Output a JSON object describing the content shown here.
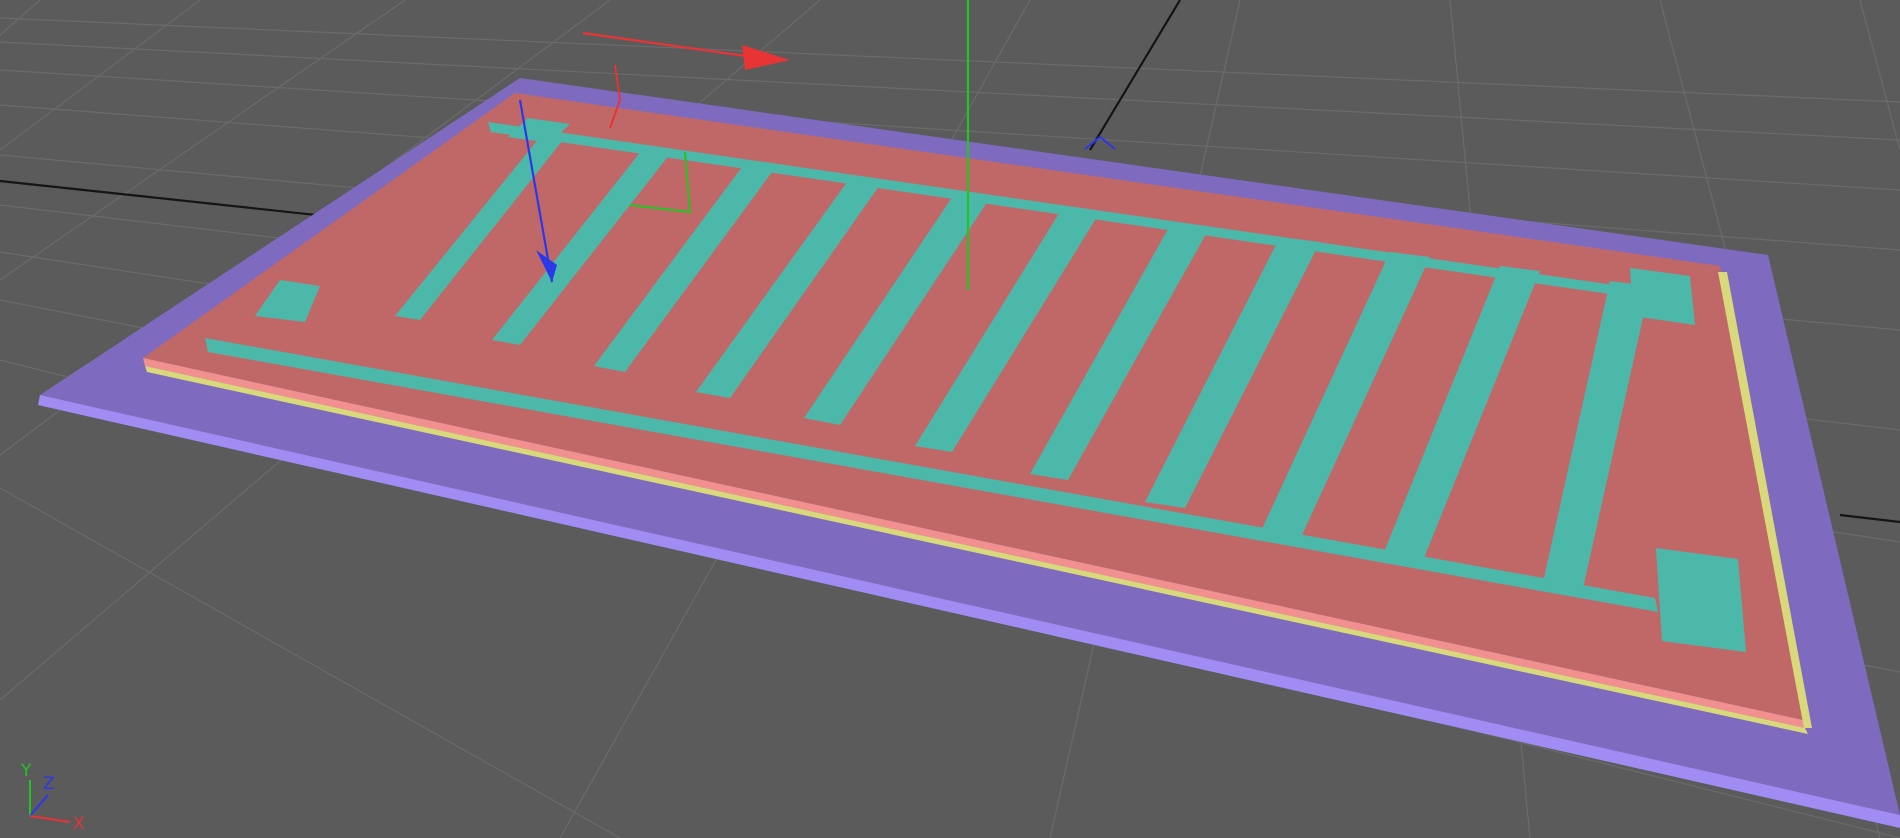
{
  "viewport": {
    "view_name": "perspective-viewport",
    "colors": {
      "background": "#5b5b5b",
      "grid_line": "#696969",
      "horizon_line": "#151515",
      "substrate": "#7e6bbf",
      "substrate_edge": "#a08cf3",
      "dielectric": "#c06868",
      "dielectric_edge": "#f29090",
      "yellow_layer": "#d9d87a",
      "electrode": "#4cb8aa",
      "electrode_edge": "#8ef2e8",
      "gizmo_x": "#e83434",
      "gizmo_y": "#22c422",
      "gizmo_z": "#2a38ec"
    }
  },
  "scene": {
    "object_type": "interdigitated-electrode-sensor",
    "finger_count": 12,
    "electrode_pad_count": 3
  },
  "axis_triad": {
    "y_label": "Y",
    "z_label": "Z",
    "x_label": "X"
  },
  "gizmo": {
    "active_axis_colors": [
      "x",
      "y",
      "z"
    ]
  }
}
